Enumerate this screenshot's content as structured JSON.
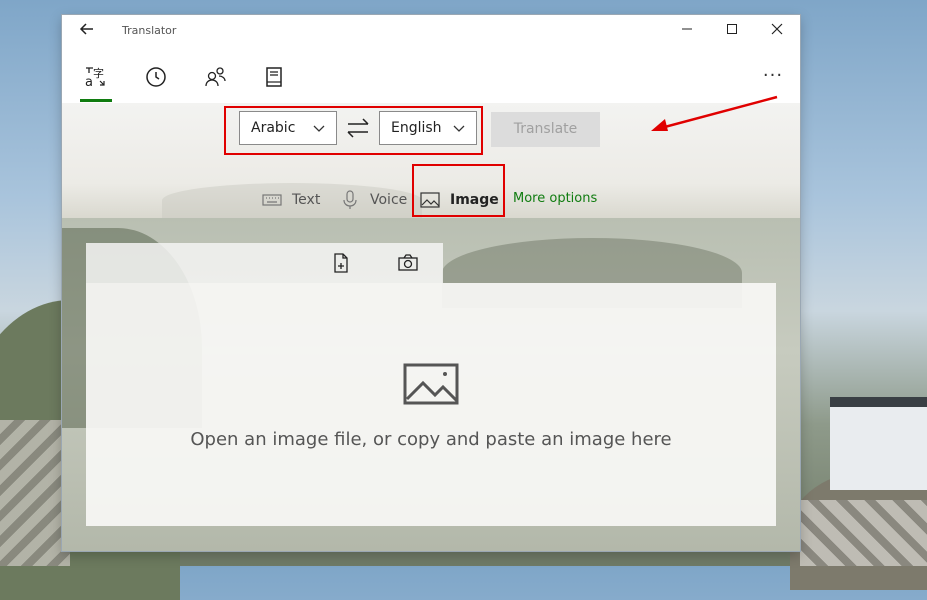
{
  "window": {
    "title": "Translator",
    "back_icon": "back-arrow-icon",
    "controls": {
      "minimize": "minimize-icon",
      "maximize": "maximize-icon",
      "close": "close-icon"
    }
  },
  "nav": {
    "items": [
      {
        "name": "translate",
        "icon": "translate-icon",
        "active": true
      },
      {
        "name": "history",
        "icon": "clock-icon",
        "active": false
      },
      {
        "name": "conversation",
        "icon": "people-icon",
        "active": false
      },
      {
        "name": "phrasebook",
        "icon": "book-icon",
        "active": false
      }
    ],
    "more_label": "···"
  },
  "translate_bar": {
    "from_language": "Arabic",
    "to_language": "English",
    "translate_label": "Translate"
  },
  "modes": {
    "text_label": "Text",
    "voice_label": "Voice",
    "image_label": "Image",
    "selected": "Image",
    "more_options_label": "More options"
  },
  "image_panel": {
    "drop_text": "Open an image file, or copy and paste an image here"
  },
  "colors": {
    "accent": "#107c10",
    "annotation": "#e00000",
    "disabled_button": "#dcdcdc"
  }
}
